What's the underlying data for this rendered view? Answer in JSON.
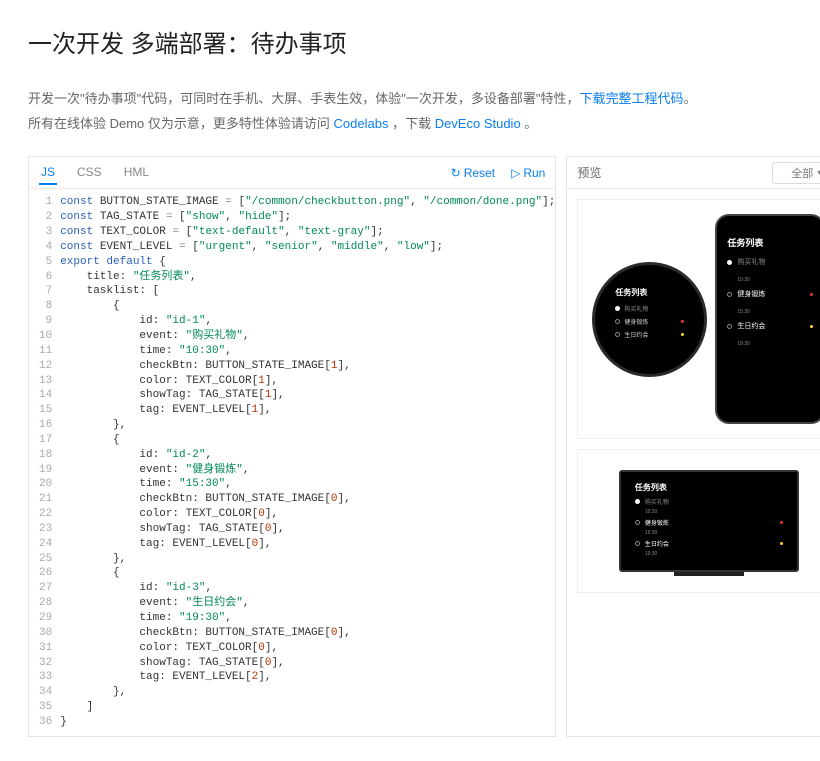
{
  "pageTitle": "一次开发 多端部署：待办事项",
  "descLine1_a": "开发一次\"待办事项\"代码，可同时在手机、大屏、手表生效，体验\"一次开发，多设备部署\"特性，",
  "descLink1": "下载完整工程代码",
  "descLine1_b": "。",
  "descLine2_a": "所有在线体验 Demo 仅为示意，更多特性体验请访问 ",
  "descLink2a": "Codelabs",
  "descLine2_mid": " ，下载 ",
  "descLink2b": "DevEco Studio",
  "descLine2_b": " 。",
  "tabs": {
    "js": "JS",
    "css": "CSS",
    "hml": "HML"
  },
  "actions": {
    "reset": "Reset",
    "run": "Run"
  },
  "previewLabel": "预览",
  "selectAll": "全部",
  "code": {
    "line1_kw": "const",
    "line1_var": " BUTTON_STATE_IMAGE ",
    "line1_op": "=",
    "line1_rest": " [",
    "line1_s1": "\"/common/checkbutton.png\"",
    "line1_c": ", ",
    "line1_s2": "\"/common/done.png\"",
    "line1_end": "];",
    "line2_kw": "const",
    "line2_var": " TAG_STATE ",
    "line2_op": "=",
    "line2_rest": " [",
    "line2_s1": "\"show\"",
    "line2_c": ", ",
    "line2_s2": "\"hide\"",
    "line2_end": "];",
    "line3_kw": "const",
    "line3_var": " TEXT_COLOR ",
    "line3_op": "=",
    "line3_rest": " [",
    "line3_s1": "\"text-default\"",
    "line3_c": ", ",
    "line3_s2": "\"text-gray\"",
    "line3_end": "];",
    "line4_kw": "const",
    "line4_var": " EVENT_LEVEL ",
    "line4_op": "=",
    "line4_rest": " [",
    "line4_s1": "\"urgent\"",
    "line4_c": ", ",
    "line4_s2": "\"senior\"",
    "line4_c2": ", ",
    "line4_s3": "\"middle\"",
    "line4_c3": ", ",
    "line4_s4": "\"low\"",
    "line4_end": "];",
    "line5_kw": "export default",
    "line5_rest": " {",
    "line6_prop": "    title: ",
    "line6_val": "\"任务列表\"",
    "line6_end": ",",
    "line7": "    tasklist: [",
    "line8": "        {",
    "line9_prop": "            id: ",
    "line9_val": "\"id-1\"",
    "line9_end": ",",
    "line10_prop": "            event: ",
    "line10_val": "\"购买礼物\"",
    "line10_end": ",",
    "line11_prop": "            time: ",
    "line11_val": "\"10:30\"",
    "line11_end": ",",
    "line12_prop": "            checkBtn: BUTTON_STATE_IMAGE[",
    "line12_n": "1",
    "line12_end": "],",
    "line13_prop": "            color: TEXT_COLOR[",
    "line13_n": "1",
    "line13_end": "],",
    "line14_prop": "            showTag: TAG_STATE[",
    "line14_n": "1",
    "line14_end": "],",
    "line15_prop": "            tag: EVENT_LEVEL[",
    "line15_n": "1",
    "line15_end": "],",
    "line16": "        },",
    "line17": "        {",
    "line18_prop": "            id: ",
    "line18_val": "\"id-2\"",
    "line18_end": ",",
    "line19_prop": "            event: ",
    "line19_val": "\"健身锻炼\"",
    "line19_end": ",",
    "line20_prop": "            time: ",
    "line20_val": "\"15:30\"",
    "line20_end": ",",
    "line21_prop": "            checkBtn: BUTTON_STATE_IMAGE[",
    "line21_n": "0",
    "line21_end": "],",
    "line22_prop": "            color: TEXT_COLOR[",
    "line22_n": "0",
    "line22_end": "],",
    "line23_prop": "            showTag: TAG_STATE[",
    "line23_n": "0",
    "line23_end": "],",
    "line24_prop": "            tag: EVENT_LEVEL[",
    "line24_n": "0",
    "line24_end": "],",
    "line25": "        },",
    "line26": "        {",
    "line27_prop": "            id: ",
    "line27_val": "\"id-3\"",
    "line27_end": ",",
    "line28_prop": "            event: ",
    "line28_val": "\"生日约会\"",
    "line28_end": ",",
    "line29_prop": "            time: ",
    "line29_val": "\"19:30\"",
    "line29_end": ",",
    "line30_prop": "            checkBtn: BUTTON_STATE_IMAGE[",
    "line30_n": "0",
    "line30_end": "],",
    "line31_prop": "            color: TEXT_COLOR[",
    "line31_n": "0",
    "line31_end": "],",
    "line32_prop": "            showTag: TAG_STATE[",
    "line32_n": "0",
    "line32_end": "],",
    "line33_prop": "            tag: EVENT_LEVEL[",
    "line33_n": "2",
    "line33_end": "],",
    "line34": "        },",
    "line35": "    ]",
    "line36": "}"
  },
  "devices": {
    "listTitle": "任务列表",
    "items": [
      {
        "label": "购买礼物",
        "time": "10:30",
        "done": true
      },
      {
        "label": "健身锻炼",
        "time": "15:30",
        "done": false,
        "badge": "r"
      },
      {
        "label": "生日约会",
        "time": "19:30",
        "done": false,
        "badge": "y"
      }
    ]
  }
}
